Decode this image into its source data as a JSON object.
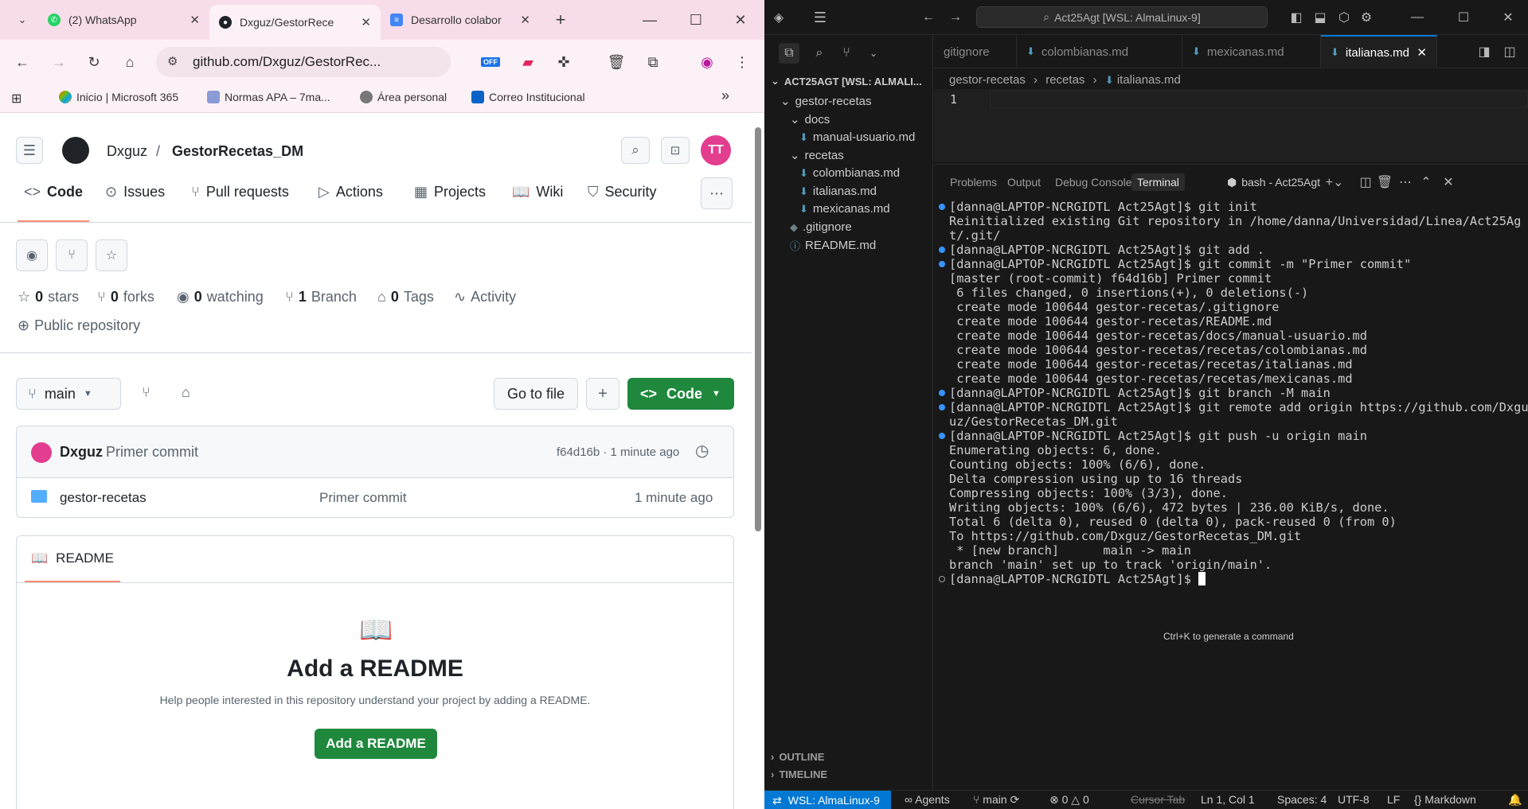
{
  "browser": {
    "tabs": [
      {
        "title": "(2) WhatsApp",
        "favicon": "whatsapp-icon",
        "color": "#25d366"
      },
      {
        "title": "Dxguz/GestorRece",
        "favicon": "github-icon",
        "color": "#1f2328"
      },
      {
        "title": "Desarrollo colabor",
        "favicon": "docs-icon",
        "color": "#4285f4"
      }
    ],
    "new_tab": "+",
    "url": "github.com/Dxguz/GestorRec...",
    "extension_badge": "OFF",
    "bookmarks": [
      {
        "label": "Inicio | Microsoft 365"
      },
      {
        "label": "Normas APA – 7ma..."
      },
      {
        "label": "Área personal"
      },
      {
        "label": "Correo Institucional"
      }
    ],
    "bookmarks_more": "»"
  },
  "github": {
    "owner": "Dxguz",
    "separator": "/",
    "repo": "GestorRecetas_DM",
    "avatar_initials": "TT",
    "nav_tabs": [
      {
        "label": "Code"
      },
      {
        "label": "Issues"
      },
      {
        "label": "Pull requests"
      },
      {
        "label": "Actions"
      },
      {
        "label": "Projects"
      },
      {
        "label": "Wiki"
      },
      {
        "label": "Security"
      }
    ],
    "stats": {
      "stars_count": "0",
      "stars_label": "stars",
      "forks_count": "0",
      "forks_label": "forks",
      "watching_count": "0",
      "watching_label": "watching",
      "branch_count": "1",
      "branch_label": "Branch",
      "tags_count": "0",
      "tags_label": "Tags",
      "activity_label": "Activity"
    },
    "visibility": "Public repository",
    "branch_selector": "main",
    "go_to_file": "Go to file",
    "add_file": "+",
    "code_button": "Code",
    "commit": {
      "author": "Dxguz",
      "message": "Primer commit",
      "meta": "f64d16b · 1 minute ago"
    },
    "files": [
      {
        "name": "gestor-recetas",
        "message": "Primer commit",
        "time": "1 minute ago"
      }
    ],
    "readme_tab": "README",
    "readme_title": "Add a README",
    "readme_desc": "Help people interested in this repository understand your project by adding a README.",
    "readme_button": "Add a README",
    "accent_green": "#1f883d",
    "tab_underline": "#fd8c73"
  },
  "vscode": {
    "search": "Act25Agt [WSL: AlmaLinux-9]",
    "explorer_root": "ACT25AGT [WSL: ALMALI...",
    "tree": {
      "gestor": "gestor-recetas",
      "docs": "docs",
      "manual": "manual-usuario.md",
      "recetas": "recetas",
      "colombianas": "colombianas.md",
      "italianas": "italianas.md",
      "mexicanas": "mexicanas.md",
      "gitignore": ".gitignore",
      "readme": "README.md"
    },
    "outline": "OUTLINE",
    "timeline": "TIMELINE",
    "editor_tabs": [
      {
        "label": "gitignore"
      },
      {
        "label": "colombianas.md"
      },
      {
        "label": "mexicanas.md"
      },
      {
        "label": "italianas.md"
      }
    ],
    "breadcrumb": [
      "gestor-recetas",
      "recetas",
      "italianas.md"
    ],
    "line_number": "1",
    "panel_tabs": [
      "Problems",
      "Output",
      "Debug Console",
      "Terminal"
    ],
    "terminal_name": "bash - Act25Agt",
    "terminal_lines": [
      {
        "dot": "blue",
        "text": "[danna@LAPTOP-NCRGIDTL Act25Agt]$ git init"
      },
      {
        "dot": "",
        "text": "Reinitialized existing Git repository in /home/danna/Universidad/Linea/Act25Ag"
      },
      {
        "dot": "",
        "text": "t/.git/"
      },
      {
        "dot": "blue",
        "text": "[danna@LAPTOP-NCRGIDTL Act25Agt]$ git add ."
      },
      {
        "dot": "blue",
        "text": "[danna@LAPTOP-NCRGIDTL Act25Agt]$ git commit -m \"Primer commit\""
      },
      {
        "dot": "",
        "text": "[master (root-commit) f64d16b] Primer commit"
      },
      {
        "dot": "",
        "text": " 6 files changed, 0 insertions(+), 0 deletions(-)"
      },
      {
        "dot": "",
        "text": " create mode 100644 gestor-recetas/.gitignore"
      },
      {
        "dot": "",
        "text": " create mode 100644 gestor-recetas/README.md"
      },
      {
        "dot": "",
        "text": " create mode 100644 gestor-recetas/docs/manual-usuario.md"
      },
      {
        "dot": "",
        "text": " create mode 100644 gestor-recetas/recetas/colombianas.md"
      },
      {
        "dot": "",
        "text": " create mode 100644 gestor-recetas/recetas/italianas.md"
      },
      {
        "dot": "",
        "text": " create mode 100644 gestor-recetas/recetas/mexicanas.md"
      },
      {
        "dot": "blue",
        "text": "[danna@LAPTOP-NCRGIDTL Act25Agt]$ git branch -M main"
      },
      {
        "dot": "blue",
        "text": "[danna@LAPTOP-NCRGIDTL Act25Agt]$ git remote add origin https://github.com/Dxgu"
      },
      {
        "dot": "",
        "text": "uz/GestorRecetas_DM.git"
      },
      {
        "dot": "blue",
        "text": "[danna@LAPTOP-NCRGIDTL Act25Agt]$ git push -u origin main"
      },
      {
        "dot": "",
        "text": "Enumerating objects: 6, done."
      },
      {
        "dot": "",
        "text": "Counting objects: 100% (6/6), done."
      },
      {
        "dot": "",
        "text": "Delta compression using up to 16 threads"
      },
      {
        "dot": "",
        "text": "Compressing objects: 100% (3/3), done."
      },
      {
        "dot": "",
        "text": "Writing objects: 100% (6/6), 472 bytes | 236.00 KiB/s, done."
      },
      {
        "dot": "",
        "text": "Total 6 (delta 0), reused 0 (delta 0), pack-reused 0 (from 0)"
      },
      {
        "dot": "",
        "text": "To https://github.com/Dxguz/GestorRecetas_DM.git"
      },
      {
        "dot": "",
        "text": " * [new branch]      main -> main"
      },
      {
        "dot": "",
        "text": "branch 'main' set up to track 'origin/main'."
      }
    ],
    "prompt": "[danna@LAPTOP-NCRGIDTL Act25Agt]$ ",
    "hint": "Ctrl+K to generate a command",
    "status": {
      "remote": "WSL: AlmaLinux-9",
      "agents": "Agents",
      "branch": "main",
      "problems": "0",
      "warnings": "0",
      "cursor_tab": "Cursor Tab",
      "position": "Ln 1, Col 1",
      "spaces": "Spaces: 4",
      "encoding": "UTF-8",
      "eol": "LF",
      "language": "Markdown"
    },
    "accent_blue": "#0078d4"
  }
}
